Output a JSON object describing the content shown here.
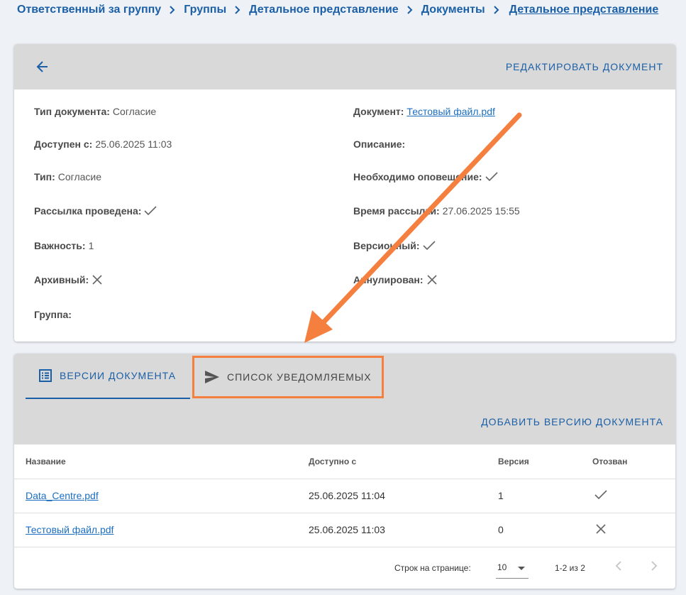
{
  "breadcrumb": {
    "items": [
      "Ответственный за группу",
      "Группы",
      "Детальное представление",
      "Документы",
      "Детальное представление"
    ]
  },
  "document_card": {
    "edit_label": "РЕДАКТИРОВАТЬ ДОКУМЕНТ",
    "left_fields": [
      {
        "label": "Тип документа:",
        "value": "Согласие"
      },
      {
        "label": "Доступен с:",
        "value": "25.06.2025 11:03"
      },
      {
        "label": "Тип:",
        "value": "Согласие"
      },
      {
        "label": "Рассылка проведена:",
        "icon": "check-icon"
      },
      {
        "label": "Важность:",
        "value": "1"
      },
      {
        "label": "Архивный:",
        "icon": "cross-icon"
      },
      {
        "label": "Группа:"
      }
    ],
    "right_fields": [
      {
        "label": "Документ:",
        "value": "Тестовый файл.pdf"
      },
      {
        "label": "Описание:"
      },
      {
        "label": "Необходимо оповещение:",
        "icon": "check-icon"
      },
      {
        "label": "Время рассылки:",
        "value": "27.06.2025 15:55"
      },
      {
        "label": "Версионный:",
        "icon": "check-icon"
      },
      {
        "label": "Аннулирован:",
        "icon": "cross-icon"
      }
    ]
  },
  "versions_card": {
    "tabs": [
      {
        "label": "ВЕРСИИ ДОКУМЕНТА",
        "icon": "list-icon",
        "active": true
      },
      {
        "label": "СПИСОК УВЕДОМЛЯЕМЫХ",
        "icon": "send-icon",
        "active": false
      }
    ],
    "add_version_label": "ДОБАВИТЬ ВЕРСИЮ ДОКУМЕНТА",
    "columns": [
      "Название",
      "Доступно с",
      "Версия",
      "Отозван"
    ],
    "rows": [
      {
        "name": "Data_Centre.pdf",
        "available": "25.06.2025 11:04",
        "version": "1",
        "revoked_icon": "check-icon"
      },
      {
        "name": "Тестовый файл.pdf",
        "available": "25.06.2025 11:03",
        "version": "0",
        "revoked_icon": "cross-icon"
      }
    ],
    "pagination": {
      "rows_per_page_label": "Строк на странице:",
      "rows_per_page": "10",
      "range": "1-2 из 2"
    }
  },
  "colors": {
    "accent": "#1b5fa6",
    "link": "#1b6fc0",
    "highlight": "#f47f3e",
    "header_bg": "#d9d9d9"
  }
}
